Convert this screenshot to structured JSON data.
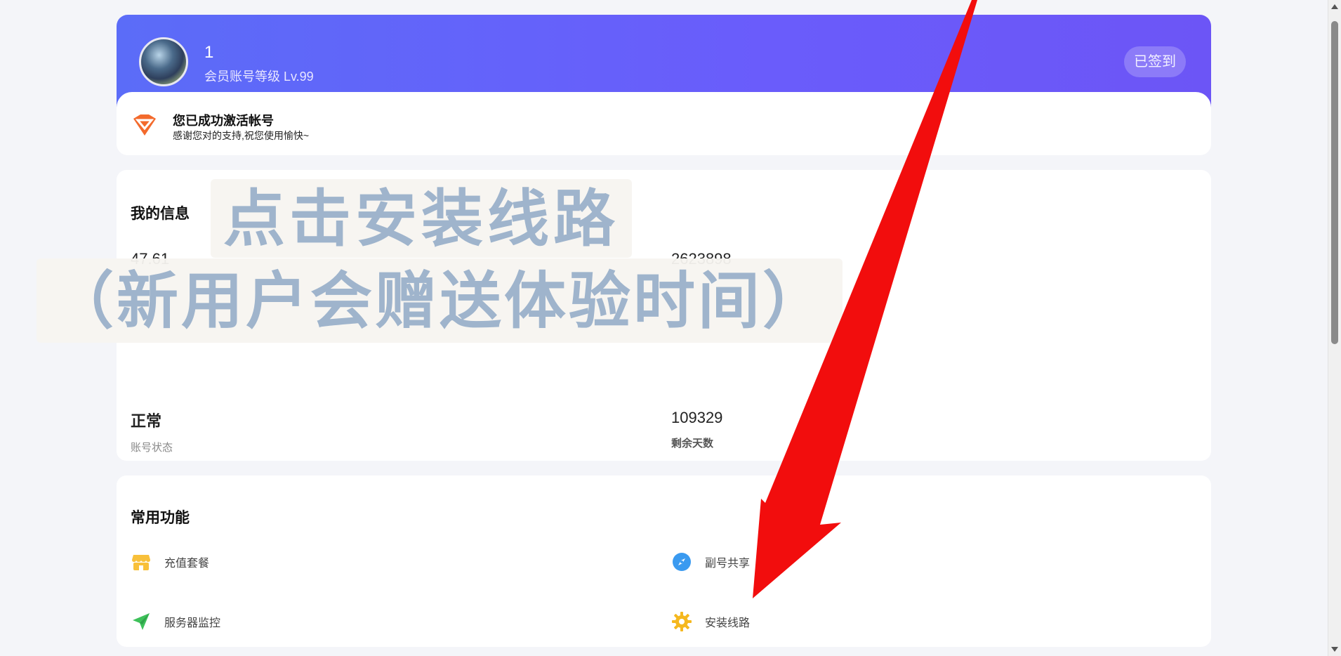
{
  "header": {
    "user_name": "1",
    "user_level": "会员账号等级 Lv.99",
    "checkin_label": "已签到",
    "activated_title": "您已成功激活帐号",
    "activated_sub": "感谢您对的支持,祝您使用愉快~"
  },
  "info": {
    "title": "我的信息",
    "stats": [
      {
        "value": "47.61"
      },
      {
        "value": "2623898"
      },
      {
        "value": "正常",
        "label": "账号状态"
      },
      {
        "value": "109329",
        "label": "剩余天数"
      }
    ]
  },
  "overlay": {
    "line1": "点击安装线路",
    "line2": "（新用户会赠送体验时间）"
  },
  "functions": {
    "title": "常用功能",
    "items": [
      {
        "label": "充值套餐",
        "icon": "store-icon",
        "color": "#f8c03a"
      },
      {
        "label": "副号共享",
        "icon": "compass-icon",
        "color": "#3a9af0"
      },
      {
        "label": "服务器监控",
        "icon": "paper-plane-icon",
        "color": "#3ec15a"
      },
      {
        "label": "安装线路",
        "icon": "gear-icon",
        "color": "#f5b81f"
      }
    ]
  },
  "colors": {
    "header_gradient_start": "#5b6cf8",
    "header_gradient_end": "#6c55f6",
    "arrow": "#f20d0d",
    "overlay_text": "#9fb4cc"
  }
}
